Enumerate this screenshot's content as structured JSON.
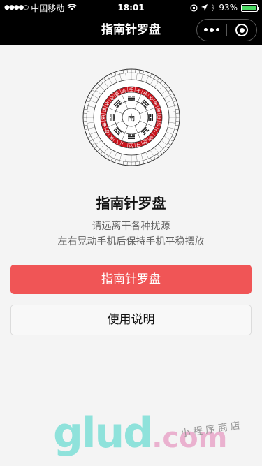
{
  "status_bar": {
    "carrier": "中国移动",
    "time": "18:01",
    "battery": "93%",
    "battery_level": 0.93
  },
  "nav": {
    "title": "指南针罗盘"
  },
  "compass": {
    "center_label": "南",
    "ring_labels": [
      "壬",
      "子",
      "癸",
      "丑",
      "艮",
      "寅",
      "甲",
      "卯",
      "乙",
      "辰",
      "巽",
      "巳",
      "丙",
      "午",
      "丁",
      "未",
      "坤",
      "申",
      "庚",
      "酉",
      "辛",
      "戌",
      "乾",
      "亥"
    ]
  },
  "main": {
    "heading": "指南针罗盘",
    "hint_1": "请远离干各种扰源",
    "hint_2": "左右晃动手机后保持手机平稳摆放",
    "primary_button": "指南针罗盘",
    "secondary_button": "使用说明"
  },
  "watermark": {
    "logo": "glud",
    "logo_suffix": ".com",
    "text": "小程序商店"
  },
  "colors": {
    "primary": "#f05556",
    "compass_red": "#c9151e",
    "nav_bg": "#000000"
  }
}
